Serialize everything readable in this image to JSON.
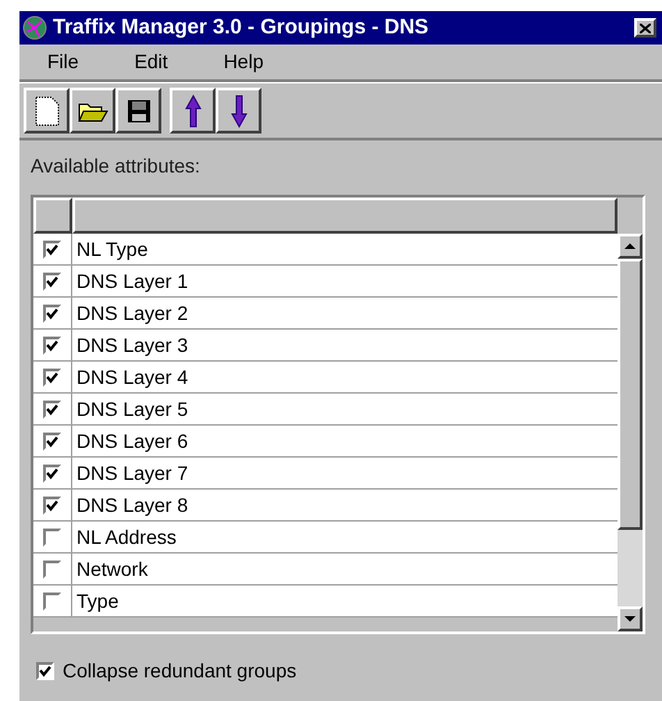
{
  "window": {
    "title": "Traffix Manager 3.0 - Groupings - DNS"
  },
  "menu": [
    "File",
    "Edit",
    "Help"
  ],
  "label": "Available attributes:",
  "attributes": [
    {
      "name": "NL Type",
      "checked": true
    },
    {
      "name": "DNS Layer 1",
      "checked": true
    },
    {
      "name": "DNS Layer 2",
      "checked": true
    },
    {
      "name": "DNS Layer 3",
      "checked": true
    },
    {
      "name": "DNS Layer 4",
      "checked": true
    },
    {
      "name": "DNS Layer 5",
      "checked": true
    },
    {
      "name": "DNS Layer 6",
      "checked": true
    },
    {
      "name": "DNS Layer 7",
      "checked": true
    },
    {
      "name": "DNS Layer 8",
      "checked": true
    },
    {
      "name": "NL Address",
      "checked": false
    },
    {
      "name": "Network",
      "checked": false
    },
    {
      "name": "Type",
      "checked": false
    }
  ],
  "collapse": {
    "label": "Collapse redundant groups",
    "checked": true
  }
}
